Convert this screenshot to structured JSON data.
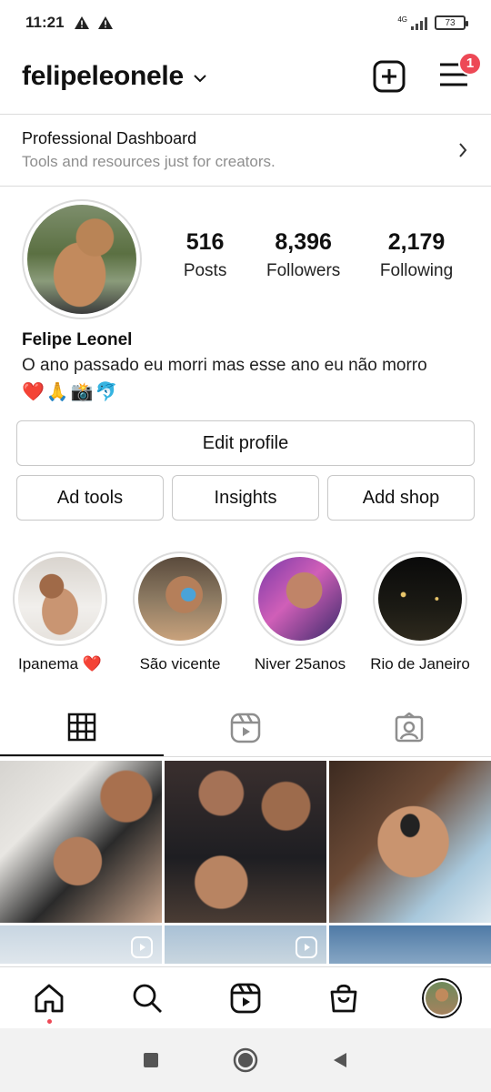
{
  "status_bar": {
    "time": "11:21",
    "network": "4G",
    "battery": "73"
  },
  "header": {
    "username": "felipeleonele",
    "notification_count": "1"
  },
  "dashboard": {
    "title": "Professional Dashboard",
    "subtitle": "Tools and resources just for creators."
  },
  "profile": {
    "stats": [
      {
        "value": "516",
        "label": "Posts"
      },
      {
        "value": "8,396",
        "label": "Followers"
      },
      {
        "value": "2,179",
        "label": "Following"
      }
    ],
    "name": "Felipe Leonel",
    "bio": "O ano passado eu morri mas esse ano eu não morro",
    "bio_emoji": "❤️🙏📸🐬"
  },
  "buttons": {
    "edit_profile": "Edit profile",
    "ad_tools": "Ad tools",
    "insights": "Insights",
    "add_shop": "Add shop"
  },
  "highlights": [
    {
      "label": "Ipanema ❤️"
    },
    {
      "label": "São vicente"
    },
    {
      "label": "Niver 25anos"
    },
    {
      "label": "Rio de Janeiro"
    }
  ],
  "tabs": [
    "grid",
    "reels",
    "tagged"
  ],
  "colors": {
    "notification": "#ed4956",
    "border": "#dbdbdb",
    "secondary_text": "#8e8e8e"
  },
  "icons": {
    "header": [
      "chevron-down-icon",
      "new-post-icon",
      "menu-icon"
    ],
    "bottom_nav": [
      "home-icon",
      "search-icon",
      "reels-icon",
      "shop-icon",
      "profile-avatar"
    ],
    "system_nav": [
      "recents-icon",
      "home-circle-icon",
      "back-icon"
    ]
  }
}
